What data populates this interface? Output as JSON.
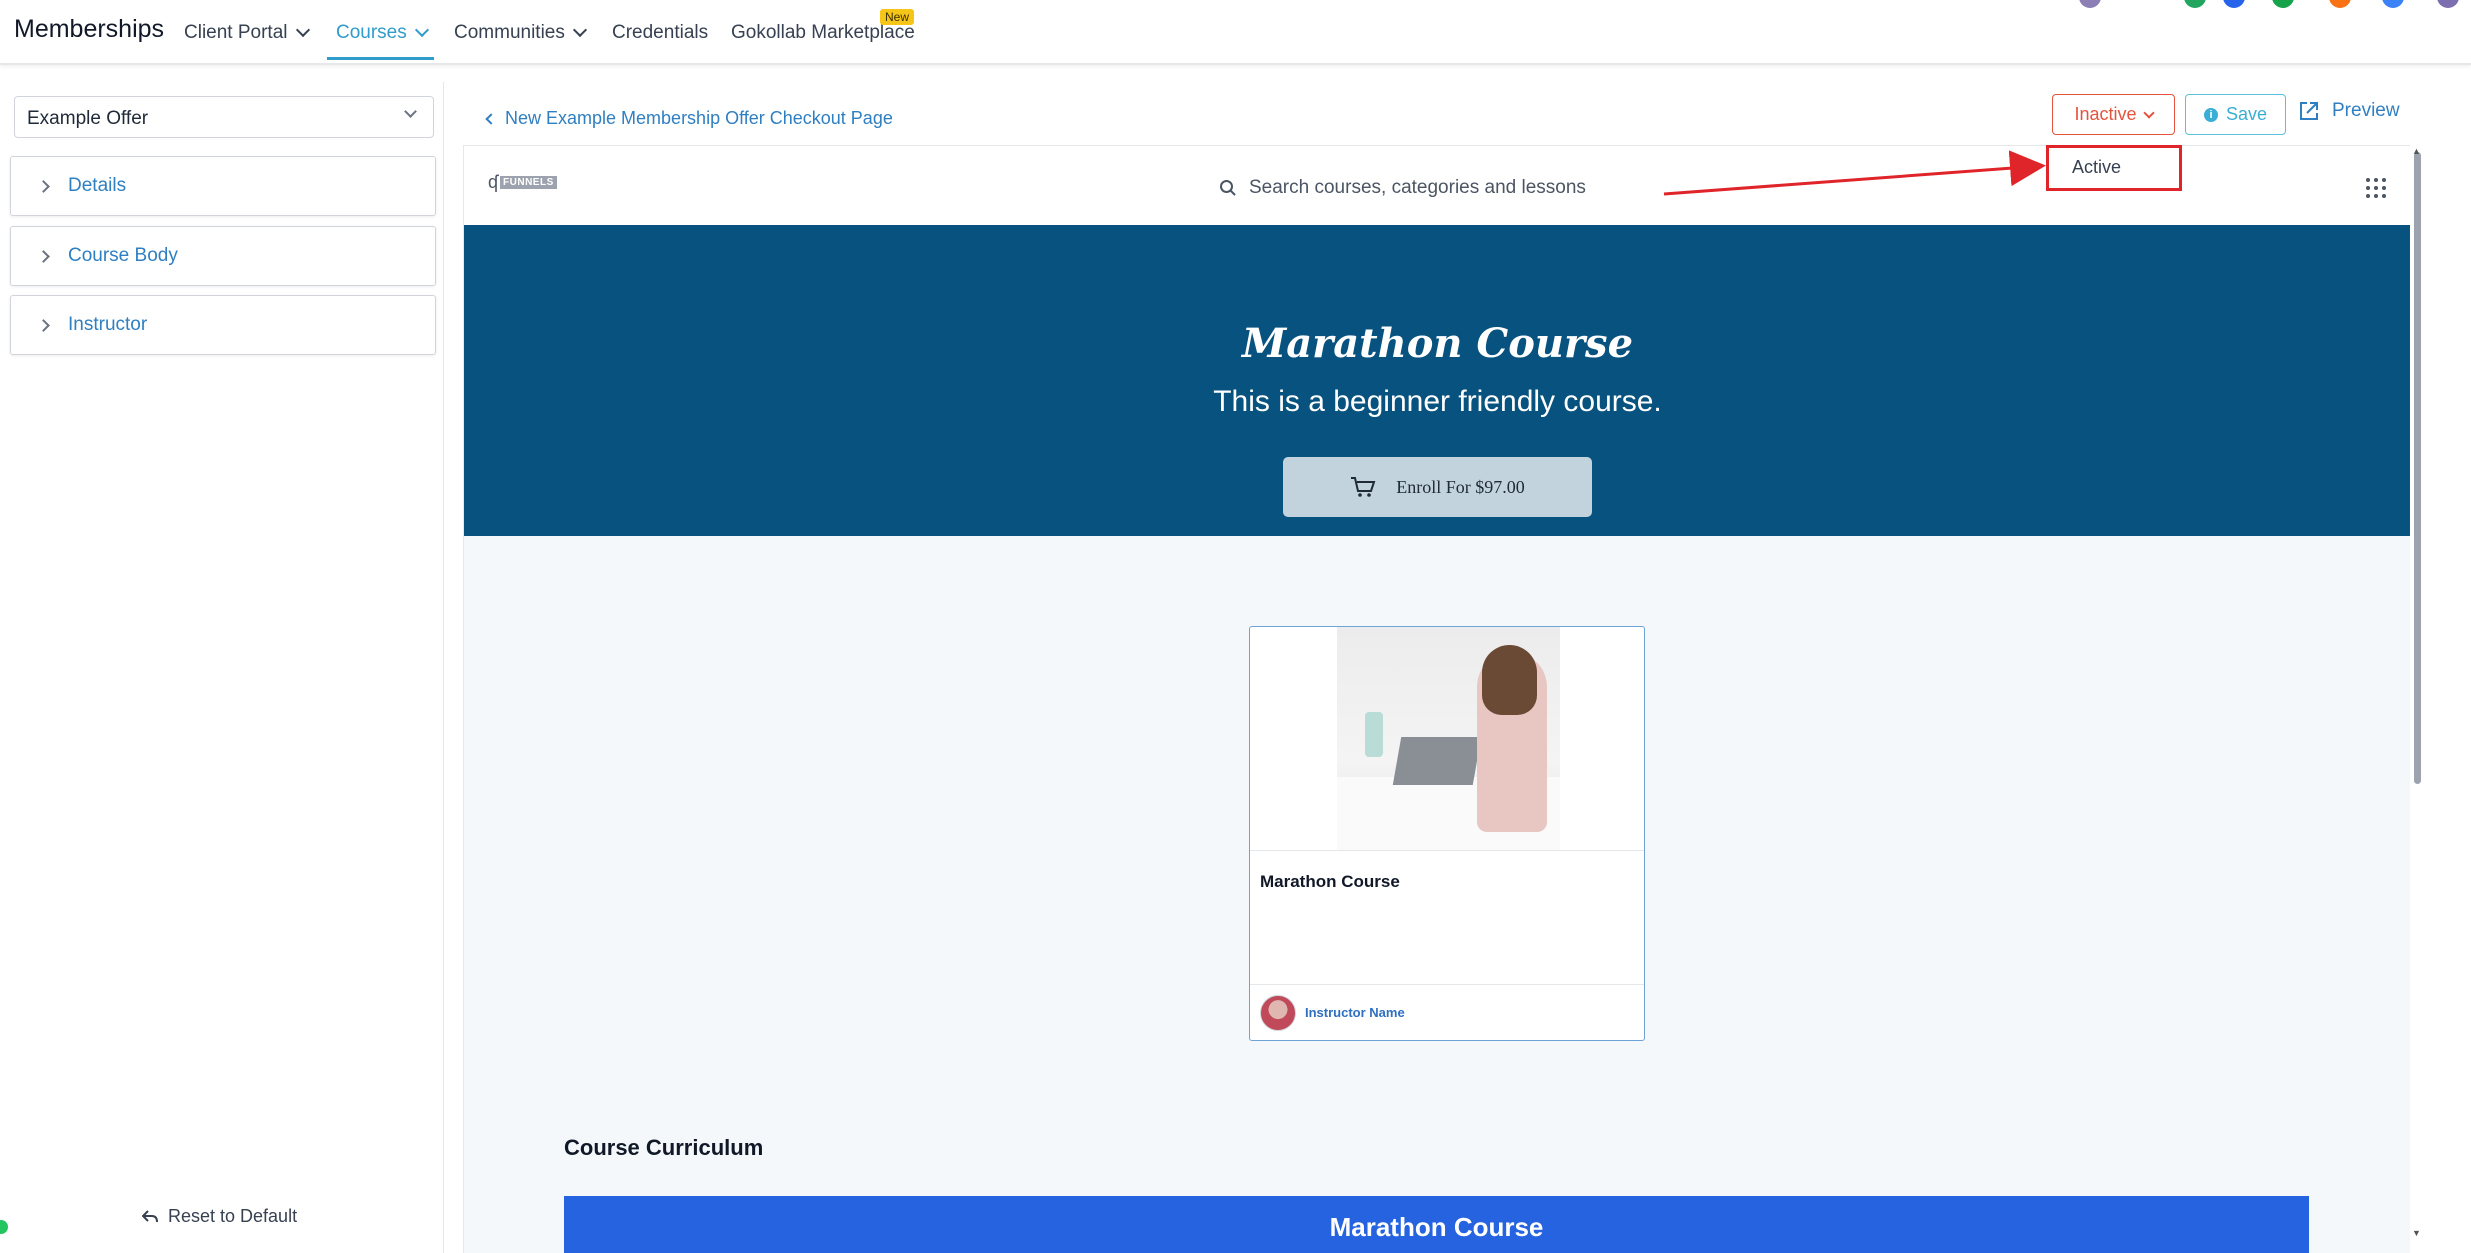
{
  "topnav": {
    "brand": "Memberships",
    "items": [
      {
        "label": "Client Portal"
      },
      {
        "label": "Courses"
      },
      {
        "label": "Communities"
      },
      {
        "label": "Credentials"
      },
      {
        "label": "Gokollab Marketplace"
      }
    ],
    "new_badge": "New",
    "accent_color": "#2f9ccb"
  },
  "sidebar": {
    "offer_select": "Example Offer",
    "sections": [
      {
        "label": "Details"
      },
      {
        "label": "Course Body"
      },
      {
        "label": "Instructor"
      }
    ],
    "reset_label": "Reset to Default"
  },
  "editor": {
    "back_label": "New Example Membership Offer Checkout Page",
    "status_label": "Inactive",
    "save_label": "Save",
    "preview_label": "Preview",
    "dropdown_option": "Active"
  },
  "preview": {
    "logo_text": "FUNNELS",
    "search_placeholder": "Search courses, categories and lessons",
    "hero_title": "Marathon Course",
    "hero_subtitle": "This is a beginner friendly course.",
    "enroll_label": "Enroll For $97.00",
    "hero_color": "#07527e",
    "card_title": "Marathon Course",
    "instructor_name": "Instructor Name",
    "curriculum_heading": "Course Curriculum",
    "curriculum_bar_title": "Marathon Course"
  }
}
